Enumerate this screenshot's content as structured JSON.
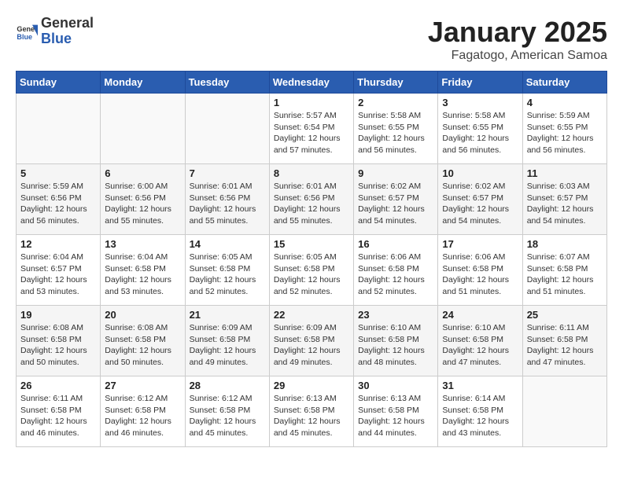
{
  "header": {
    "logo_text_general": "General",
    "logo_text_blue": "Blue",
    "month_year": "January 2025",
    "location": "Fagatogo, American Samoa"
  },
  "weekdays": [
    "Sunday",
    "Monday",
    "Tuesday",
    "Wednesday",
    "Thursday",
    "Friday",
    "Saturday"
  ],
  "weeks": [
    [
      {
        "day": "",
        "sunrise": "",
        "sunset": "",
        "daylight": ""
      },
      {
        "day": "",
        "sunrise": "",
        "sunset": "",
        "daylight": ""
      },
      {
        "day": "",
        "sunrise": "",
        "sunset": "",
        "daylight": ""
      },
      {
        "day": "1",
        "sunrise": "Sunrise: 5:57 AM",
        "sunset": "Sunset: 6:54 PM",
        "daylight": "Daylight: 12 hours and 57 minutes."
      },
      {
        "day": "2",
        "sunrise": "Sunrise: 5:58 AM",
        "sunset": "Sunset: 6:55 PM",
        "daylight": "Daylight: 12 hours and 56 minutes."
      },
      {
        "day": "3",
        "sunrise": "Sunrise: 5:58 AM",
        "sunset": "Sunset: 6:55 PM",
        "daylight": "Daylight: 12 hours and 56 minutes."
      },
      {
        "day": "4",
        "sunrise": "Sunrise: 5:59 AM",
        "sunset": "Sunset: 6:55 PM",
        "daylight": "Daylight: 12 hours and 56 minutes."
      }
    ],
    [
      {
        "day": "5",
        "sunrise": "Sunrise: 5:59 AM",
        "sunset": "Sunset: 6:56 PM",
        "daylight": "Daylight: 12 hours and 56 minutes."
      },
      {
        "day": "6",
        "sunrise": "Sunrise: 6:00 AM",
        "sunset": "Sunset: 6:56 PM",
        "daylight": "Daylight: 12 hours and 55 minutes."
      },
      {
        "day": "7",
        "sunrise": "Sunrise: 6:01 AM",
        "sunset": "Sunset: 6:56 PM",
        "daylight": "Daylight: 12 hours and 55 minutes."
      },
      {
        "day": "8",
        "sunrise": "Sunrise: 6:01 AM",
        "sunset": "Sunset: 6:56 PM",
        "daylight": "Daylight: 12 hours and 55 minutes."
      },
      {
        "day": "9",
        "sunrise": "Sunrise: 6:02 AM",
        "sunset": "Sunset: 6:57 PM",
        "daylight": "Daylight: 12 hours and 54 minutes."
      },
      {
        "day": "10",
        "sunrise": "Sunrise: 6:02 AM",
        "sunset": "Sunset: 6:57 PM",
        "daylight": "Daylight: 12 hours and 54 minutes."
      },
      {
        "day": "11",
        "sunrise": "Sunrise: 6:03 AM",
        "sunset": "Sunset: 6:57 PM",
        "daylight": "Daylight: 12 hours and 54 minutes."
      }
    ],
    [
      {
        "day": "12",
        "sunrise": "Sunrise: 6:04 AM",
        "sunset": "Sunset: 6:57 PM",
        "daylight": "Daylight: 12 hours and 53 minutes."
      },
      {
        "day": "13",
        "sunrise": "Sunrise: 6:04 AM",
        "sunset": "Sunset: 6:58 PM",
        "daylight": "Daylight: 12 hours and 53 minutes."
      },
      {
        "day": "14",
        "sunrise": "Sunrise: 6:05 AM",
        "sunset": "Sunset: 6:58 PM",
        "daylight": "Daylight: 12 hours and 52 minutes."
      },
      {
        "day": "15",
        "sunrise": "Sunrise: 6:05 AM",
        "sunset": "Sunset: 6:58 PM",
        "daylight": "Daylight: 12 hours and 52 minutes."
      },
      {
        "day": "16",
        "sunrise": "Sunrise: 6:06 AM",
        "sunset": "Sunset: 6:58 PM",
        "daylight": "Daylight: 12 hours and 52 minutes."
      },
      {
        "day": "17",
        "sunrise": "Sunrise: 6:06 AM",
        "sunset": "Sunset: 6:58 PM",
        "daylight": "Daylight: 12 hours and 51 minutes."
      },
      {
        "day": "18",
        "sunrise": "Sunrise: 6:07 AM",
        "sunset": "Sunset: 6:58 PM",
        "daylight": "Daylight: 12 hours and 51 minutes."
      }
    ],
    [
      {
        "day": "19",
        "sunrise": "Sunrise: 6:08 AM",
        "sunset": "Sunset: 6:58 PM",
        "daylight": "Daylight: 12 hours and 50 minutes."
      },
      {
        "day": "20",
        "sunrise": "Sunrise: 6:08 AM",
        "sunset": "Sunset: 6:58 PM",
        "daylight": "Daylight: 12 hours and 50 minutes."
      },
      {
        "day": "21",
        "sunrise": "Sunrise: 6:09 AM",
        "sunset": "Sunset: 6:58 PM",
        "daylight": "Daylight: 12 hours and 49 minutes."
      },
      {
        "day": "22",
        "sunrise": "Sunrise: 6:09 AM",
        "sunset": "Sunset: 6:58 PM",
        "daylight": "Daylight: 12 hours and 49 minutes."
      },
      {
        "day": "23",
        "sunrise": "Sunrise: 6:10 AM",
        "sunset": "Sunset: 6:58 PM",
        "daylight": "Daylight: 12 hours and 48 minutes."
      },
      {
        "day": "24",
        "sunrise": "Sunrise: 6:10 AM",
        "sunset": "Sunset: 6:58 PM",
        "daylight": "Daylight: 12 hours and 47 minutes."
      },
      {
        "day": "25",
        "sunrise": "Sunrise: 6:11 AM",
        "sunset": "Sunset: 6:58 PM",
        "daylight": "Daylight: 12 hours and 47 minutes."
      }
    ],
    [
      {
        "day": "26",
        "sunrise": "Sunrise: 6:11 AM",
        "sunset": "Sunset: 6:58 PM",
        "daylight": "Daylight: 12 hours and 46 minutes."
      },
      {
        "day": "27",
        "sunrise": "Sunrise: 6:12 AM",
        "sunset": "Sunset: 6:58 PM",
        "daylight": "Daylight: 12 hours and 46 minutes."
      },
      {
        "day": "28",
        "sunrise": "Sunrise: 6:12 AM",
        "sunset": "Sunset: 6:58 PM",
        "daylight": "Daylight: 12 hours and 45 minutes."
      },
      {
        "day": "29",
        "sunrise": "Sunrise: 6:13 AM",
        "sunset": "Sunset: 6:58 PM",
        "daylight": "Daylight: 12 hours and 45 minutes."
      },
      {
        "day": "30",
        "sunrise": "Sunrise: 6:13 AM",
        "sunset": "Sunset: 6:58 PM",
        "daylight": "Daylight: 12 hours and 44 minutes."
      },
      {
        "day": "31",
        "sunrise": "Sunrise: 6:14 AM",
        "sunset": "Sunset: 6:58 PM",
        "daylight": "Daylight: 12 hours and 43 minutes."
      },
      {
        "day": "",
        "sunrise": "",
        "sunset": "",
        "daylight": ""
      }
    ]
  ]
}
